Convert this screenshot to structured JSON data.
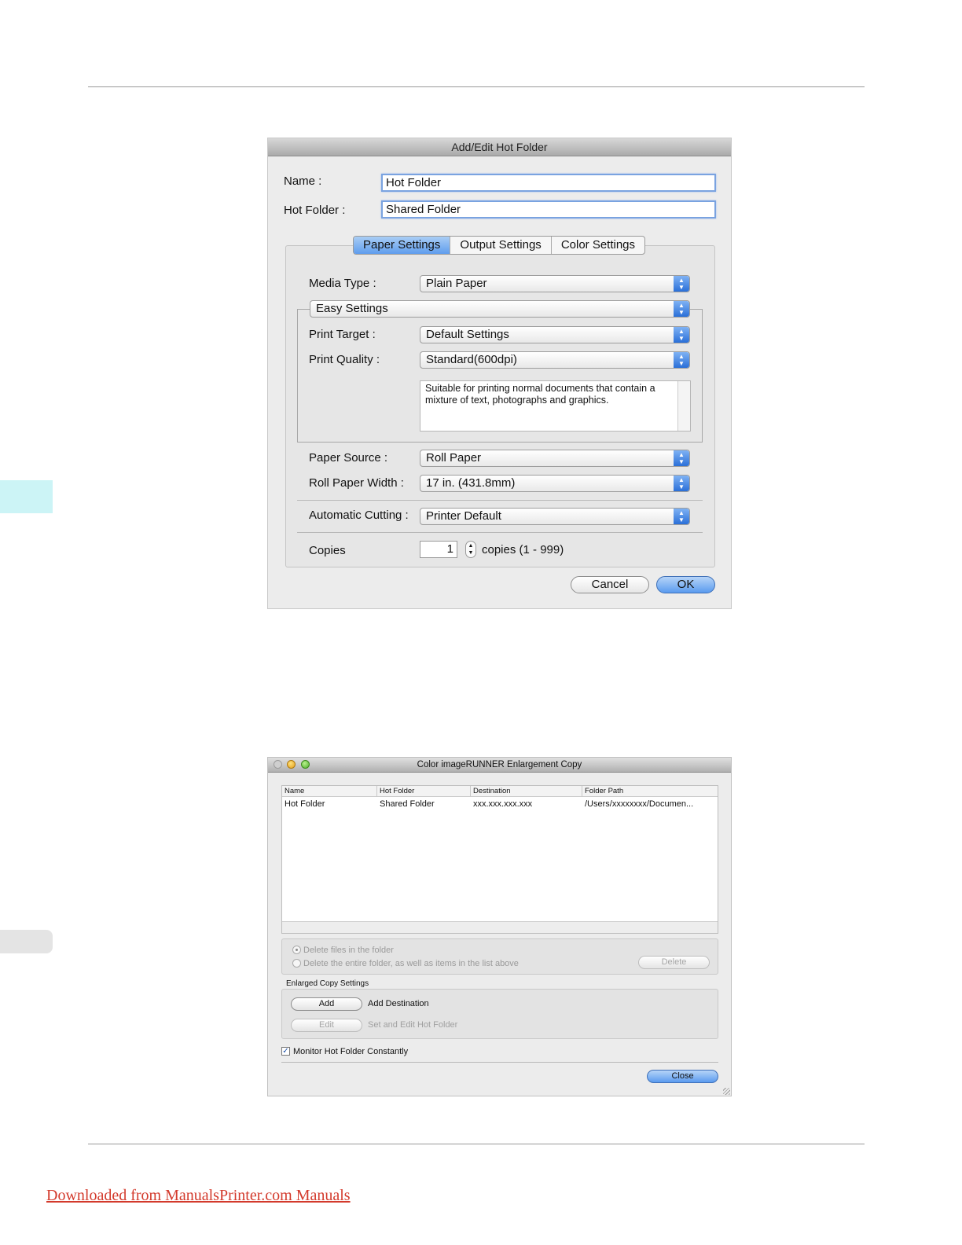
{
  "dialog1": {
    "title": "Add/Edit Hot Folder",
    "name_label": "Name :",
    "name_value": "Hot Folder",
    "hotfolder_label": "Hot Folder :",
    "hotfolder_value": "Shared Folder",
    "tabs": [
      "Paper Settings",
      "Output Settings",
      "Color Settings"
    ],
    "active_tab": "Paper Settings",
    "media_type_label": "Media Type :",
    "media_type_value": "Plain Paper",
    "mode_value": "Easy Settings",
    "print_target_label": "Print Target :",
    "print_target_value": "Default Settings",
    "print_quality_label": "Print Quality :",
    "print_quality_value": "Standard(600dpi)",
    "description": "Suitable for printing normal documents that contain a mixture of text, photographs and graphics.",
    "paper_source_label": "Paper Source :",
    "paper_source_value": "Roll Paper",
    "roll_width_label": "Roll Paper Width :",
    "roll_width_value": "17 in. (431.8mm)",
    "auto_cutting_label": "Automatic Cutting :",
    "auto_cutting_value": "Printer Default",
    "copies_label": "Copies",
    "copies_value": "1",
    "copies_range": "copies (1 - 999)",
    "cancel_label": "Cancel",
    "ok_label": "OK"
  },
  "dialog2": {
    "title": "Color imageRUNNER Enlargement Copy",
    "columns": [
      "Name",
      "Hot Folder",
      "Destination",
      "Folder Path"
    ],
    "rows": [
      [
        "Hot Folder",
        "Shared Folder",
        "xxx.xxx.xxx.xxx",
        "/Users/xxxxxxxx/Documen..."
      ]
    ],
    "radio_delete_files": "Delete files in the folder",
    "radio_delete_folder": "Delete the entire folder, as well as items in the list above",
    "delete_label": "Delete",
    "enlarged_section_label": "Enlarged Copy Settings",
    "add_label": "Add",
    "add_desc": "Add Destination",
    "edit_label": "Edit",
    "edit_desc": "Set and Edit Hot Folder",
    "monitor_label": "Monitor Hot Folder Constantly",
    "monitor_checked": true,
    "close_label": "Close"
  },
  "footer_link": "Downloaded from ManualsPrinter.com Manuals",
  "colors": {
    "accent_blue": "#5a9bef",
    "side_tab": "#ccf4f6",
    "footer_link": "#d33a2c"
  }
}
